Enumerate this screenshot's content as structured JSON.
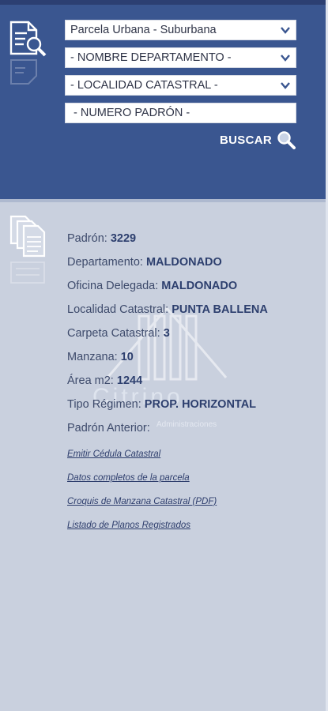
{
  "search": {
    "tipo_parcela": "Parcela Urbana - Suburbana",
    "departamento": "- NOMBRE DEPARTAMENTO -",
    "localidad": "- LOCALIDAD CATASTRAL -",
    "padron_placeholder": "- NUMERO PADRÓN  -",
    "buscar_label": "BUSCAR"
  },
  "result": {
    "padron_label": "Padrón:",
    "padron_value": "3229",
    "departamento_label": "Departamento:",
    "departamento_value": "MALDONADO",
    "oficina_label": "Oficina Delegada:",
    "oficina_value": "MALDONADO",
    "localidad_label": "Localidad Catastral:",
    "localidad_value": "PUNTA BALLENA",
    "carpeta_label": "Carpeta Catastral:",
    "carpeta_value": "3",
    "manzana_label": "Manzana:",
    "manzana_value": "10",
    "area_label": "Área m2:",
    "area_value": "1244",
    "regimen_label": "Tipo Régimen:",
    "regimen_value": "PROP. HORIZONTAL",
    "padron_anterior_label": "Padrón Anterior:"
  },
  "links": {
    "cedula": "Emitir Cédula Catastral",
    "datos": "Datos completos de la parcela",
    "croquis": "Croquis de Manzana Catastral (PDF)",
    "planos": "Listado de Planos Registrados"
  },
  "watermark": {
    "name": "Citrino",
    "sub": "Administraciones"
  },
  "icons": {
    "search_panel": "document-search-icon",
    "results": "documents-stack-icon",
    "buscar": "magnifier-icon",
    "select": "chevron-down-icon"
  },
  "colors": {
    "panel": "#3a5690",
    "background": "#c9d0de",
    "value_text": "#2d3f6e"
  }
}
